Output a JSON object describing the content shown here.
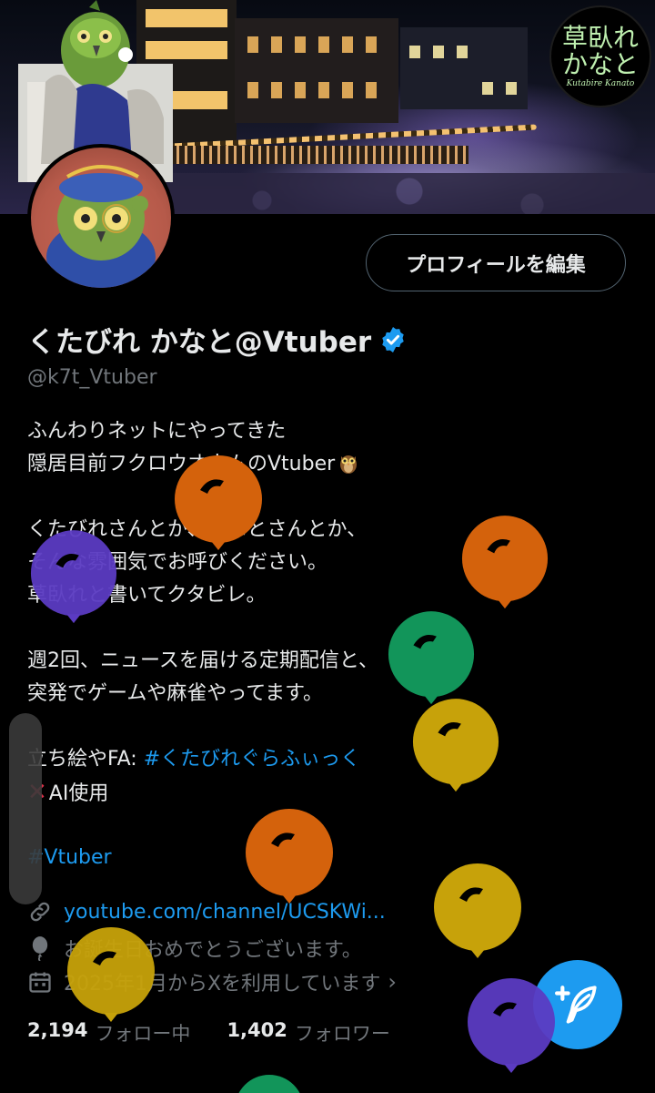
{
  "banner": {
    "logo_main": "草臥れ\nかなと",
    "logo_sub": "Kutabire Kanato"
  },
  "profile": {
    "edit_button_label": "プロフィールを編集",
    "display_name": "くたびれ かなと@Vtuber",
    "handle": "@k7t_Vtuber",
    "verified": true
  },
  "bio": {
    "line1": "ふんわりネットにやってきた",
    "line2": "隠居目前フクロウオウムのVtuber",
    "line3": "くたびれさんとか、かなとさんとか、",
    "line4": "そんな雰囲気でお呼びください。",
    "line5": "草臥れと書いてクタビレ。",
    "line6": "週2回、ニュースを届ける定期配信と、",
    "line7": "突発でゲームや麻雀やってます。",
    "line8_prefix": "立ち絵やFA: ",
    "line8_hashtag": "#くたびれぐらふぃっく",
    "line9": "AI使用",
    "hashtag": "#Vtuber"
  },
  "meta": {
    "link": "youtube.com/channel/UCSKWi...",
    "birthday": "お誕生日おめでとうございます。",
    "joined": "2025年1月からXを利用しています"
  },
  "stats": {
    "following_count": "2,194",
    "following_label": "フォロー中",
    "followers_count": "1,402",
    "followers_label": "フォロワー"
  },
  "colors": {
    "accent": "#1d9bf0",
    "balloon_orange": "#d4620c",
    "balloon_purple": "#5b3bc2",
    "balloon_green": "#12955a",
    "balloon_yellow": "#c7a20a"
  }
}
